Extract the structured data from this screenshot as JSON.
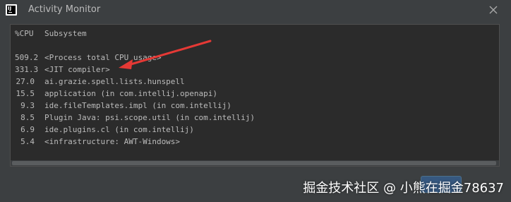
{
  "window": {
    "title": "Activity Monitor",
    "app_icon_text": "IJ"
  },
  "table": {
    "columns": [
      "%CPU",
      "Subsystem"
    ],
    "rows": [
      {
        "cpu": "509.2",
        "subsystem": "<Process total CPU usage>"
      },
      {
        "cpu": "331.3",
        "subsystem": "<JIT compiler>"
      },
      {
        "cpu": "27.0",
        "subsystem": "ai.grazie.spell.lists.hunspell"
      },
      {
        "cpu": "15.5",
        "subsystem": "application (in com.intellij.openapi)"
      },
      {
        "cpu": "9.3",
        "subsystem": "ide.fileTemplates.impl (in com.intellij)"
      },
      {
        "cpu": "8.5",
        "subsystem": "Plugin Java: psi.scope.util (in com.intellij)"
      },
      {
        "cpu": "6.9",
        "subsystem": "ide.plugins.cl (in com.intellij)"
      },
      {
        "cpu": "5.4",
        "subsystem": "<infrastructure: AWT-Windows>"
      }
    ]
  },
  "footer": {
    "button_label": "",
    "watermark": "掘金技术社区 @ 小熊在掘金78637"
  },
  "colors": {
    "arrow": "#e53935"
  }
}
